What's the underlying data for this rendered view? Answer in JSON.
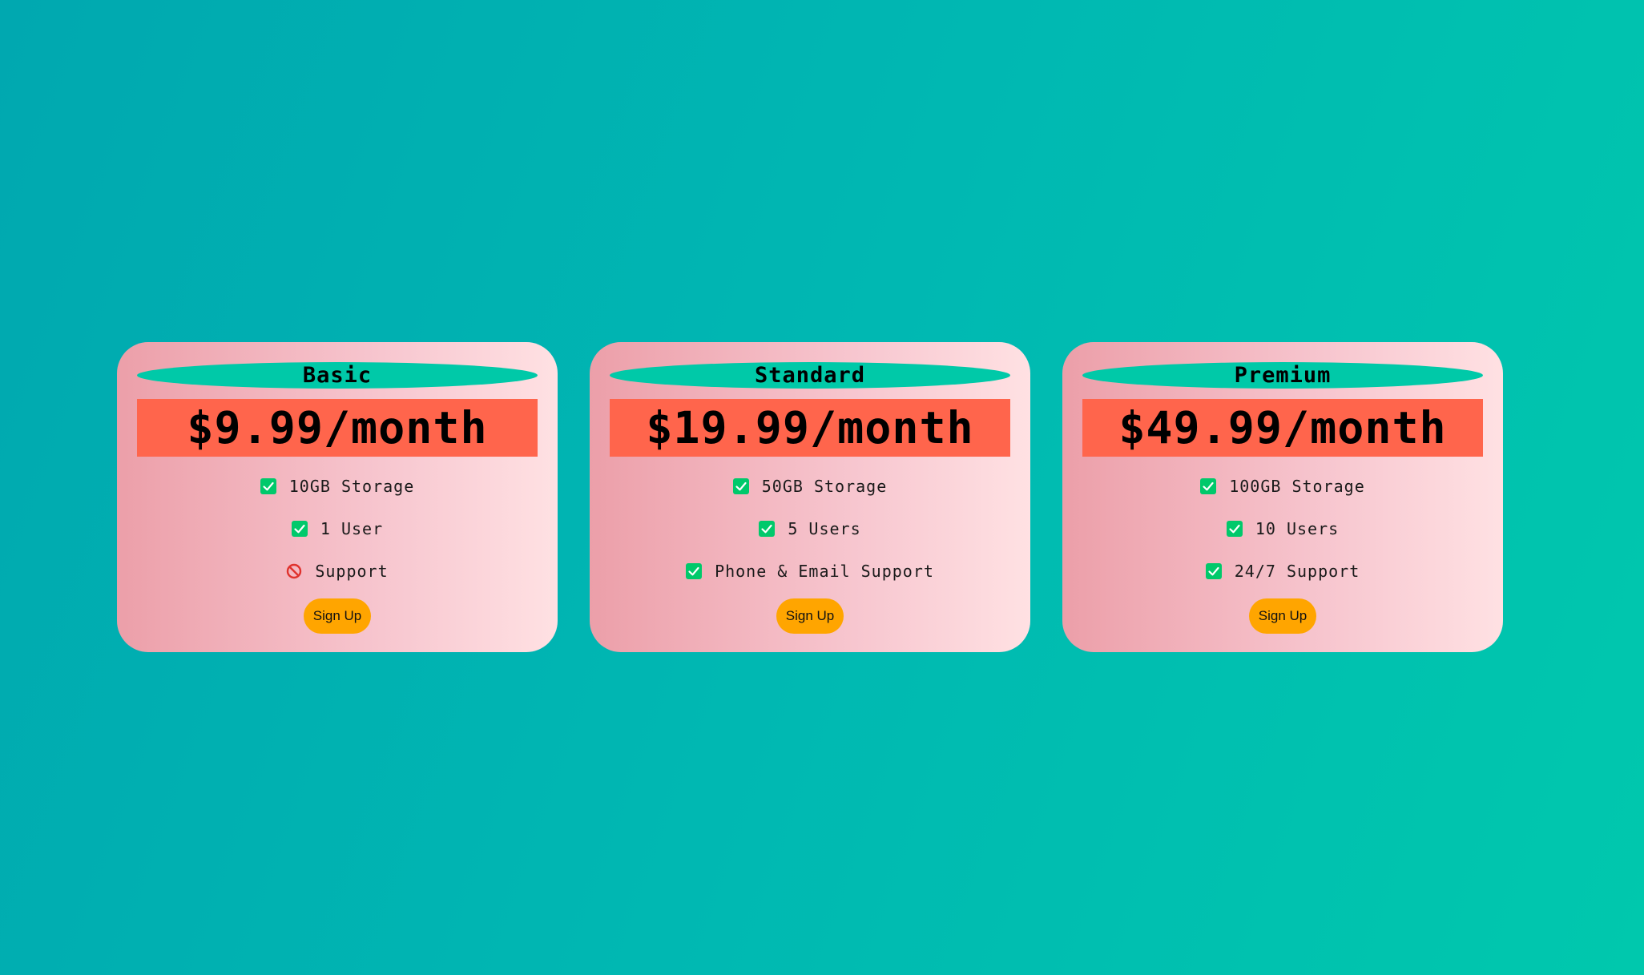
{
  "colors": {
    "background_start": "#00a8b0",
    "background_end": "#00c8ad",
    "card_start": "#ec9fa9",
    "card_end": "#ffe1e3",
    "title_pill": "#00c9a8",
    "price_bar": "#ff654c",
    "button": "#ffa500",
    "check": "#00c96b",
    "no": "#e0322d"
  },
  "plans": [
    {
      "name": "Basic",
      "price": "$9.99/month",
      "features": [
        {
          "text": "10GB Storage",
          "icon": "check-icon"
        },
        {
          "text": "1 User",
          "icon": "check-icon"
        },
        {
          "text": "Support",
          "icon": "prohibited-icon"
        }
      ],
      "button": "Sign Up"
    },
    {
      "name": "Standard",
      "price": "$19.99/month",
      "features": [
        {
          "text": "50GB Storage",
          "icon": "check-icon"
        },
        {
          "text": "5 Users",
          "icon": "check-icon"
        },
        {
          "text": "Phone & Email Support",
          "icon": "check-icon"
        }
      ],
      "button": "Sign Up"
    },
    {
      "name": "Premium",
      "price": "$49.99/month",
      "features": [
        {
          "text": "100GB Storage",
          "icon": "check-icon"
        },
        {
          "text": "10 Users",
          "icon": "check-icon"
        },
        {
          "text": "24/7 Support",
          "icon": "check-icon"
        }
      ],
      "button": "Sign Up"
    }
  ]
}
